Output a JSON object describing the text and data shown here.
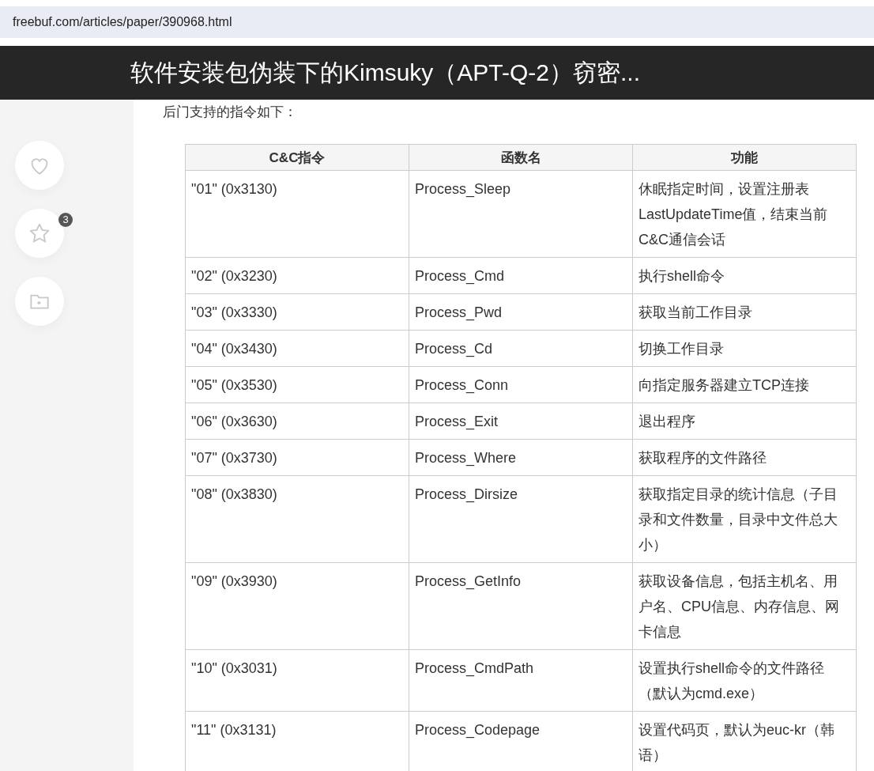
{
  "address_bar": {
    "url": "freebuf.com/articles/paper/390968.html"
  },
  "header": {
    "title": "软件安装包伪装下的Kimsuky（APT-Q-2）窃密..."
  },
  "sidebar": {
    "actions": [
      {
        "kind": "like"
      },
      {
        "kind": "favorite",
        "badge": "3"
      },
      {
        "kind": "collect"
      }
    ]
  },
  "article": {
    "intro": "后门支持的指令如下：",
    "table": {
      "columns": [
        "C&C指令",
        "函数名",
        "功能"
      ],
      "rows": [
        {
          "cells": [
            [
              "\"01\" (0x3130)"
            ],
            [
              "Process_Sleep"
            ],
            [
              "休眠指定时间，设置注册表",
              "LastUpdateTime值，结束当前",
              "C&C通信会话"
            ]
          ]
        },
        {
          "cells": [
            [
              "\"02\" (0x3230)"
            ],
            [
              "Process_Cmd"
            ],
            [
              "执行shell命令"
            ]
          ]
        },
        {
          "cells": [
            [
              "\"03\" (0x3330)"
            ],
            [
              "Process_Pwd"
            ],
            [
              "获取当前工作目录"
            ]
          ]
        },
        {
          "cells": [
            [
              "\"04\" (0x3430)"
            ],
            [
              "Process_Cd"
            ],
            [
              "切换工作目录"
            ]
          ]
        },
        {
          "cells": [
            [
              "\"05\" (0x3530)"
            ],
            [
              "Process_Conn"
            ],
            [
              "向指定服务器建立TCP连接"
            ]
          ]
        },
        {
          "cells": [
            [
              "\"06\" (0x3630)"
            ],
            [
              "Process_Exit"
            ],
            [
              "退出程序"
            ]
          ]
        },
        {
          "cells": [
            [
              "\"07\" (0x3730)"
            ],
            [
              "Process_Where"
            ],
            [
              "获取程序的文件路径"
            ]
          ]
        },
        {
          "cells": [
            [
              "\"08\" (0x3830)"
            ],
            [
              "Process_Dirsize"
            ],
            [
              "获取指定目录的统计信息（子目",
              "录和文件数量，目录中文件总大",
              "小）"
            ]
          ]
        },
        {
          "cells": [
            [
              "\"09\" (0x3930)"
            ],
            [
              "Process_GetInfo"
            ],
            [
              "获取设备信息，包括主机名、用",
              "户名、CPU信息、内存信息、网",
              "卡信息"
            ]
          ]
        },
        {
          "cells": [
            [
              "\"10\" (0x3031)"
            ],
            [
              "Process_CmdPath"
            ],
            [
              "设置执行shell命令的文件路径",
              "（默认为cmd.exe）"
            ]
          ]
        },
        {
          "cells": [
            [
              "\"11\" (0x3131)"
            ],
            [
              "Process_Codepage"
            ],
            [
              "设置代码页，默认为euc-kr（韩",
              "语）"
            ]
          ]
        }
      ]
    }
  }
}
